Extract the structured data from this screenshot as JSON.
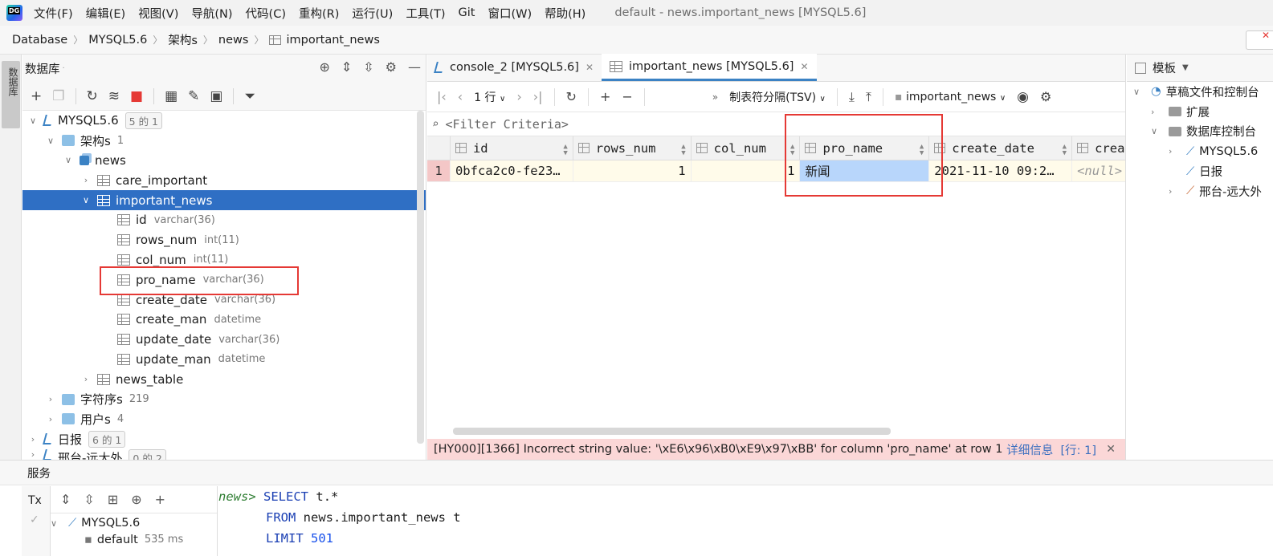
{
  "menu": {
    "items": [
      "文件(F)",
      "编辑(E)",
      "视图(V)",
      "导航(N)",
      "代码(C)",
      "重构(R)",
      "运行(U)",
      "工具(T)",
      "Git",
      "窗口(W)",
      "帮助(H)"
    ],
    "title": "default - news.important_news [MYSQL5.6]"
  },
  "breadcrumb": [
    "Database",
    "MYSQL5.6",
    "架构s",
    "news",
    "important_news"
  ],
  "leftstrip": {
    "tab_label": "数据库"
  },
  "db_panel": {
    "title": "数据库",
    "tree": {
      "root": {
        "label": "MYSQL5.6",
        "badge": "5 的 1"
      },
      "schemas": {
        "label": "架构s",
        "count": "1"
      },
      "news": {
        "label": "news"
      },
      "care_important": {
        "label": "care_important"
      },
      "important_news": {
        "label": "important_news"
      },
      "columns": [
        {
          "name": "id",
          "type": "varchar(36)"
        },
        {
          "name": "rows_num",
          "type": "int(11)"
        },
        {
          "name": "col_num",
          "type": "int(11)"
        },
        {
          "name": "pro_name",
          "type": "varchar(36)"
        },
        {
          "name": "create_date",
          "type": "varchar(36)"
        },
        {
          "name": "create_man",
          "type": "datetime"
        },
        {
          "name": "update_date",
          "type": "varchar(36)"
        },
        {
          "name": "update_man",
          "type": "datetime"
        }
      ],
      "news_table": {
        "label": "news_table"
      },
      "collations": {
        "label": "字符序s",
        "count": "219"
      },
      "users": {
        "label": "用户s",
        "count": "4"
      },
      "ribao": {
        "label": "日报",
        "badge": "6 的 1"
      },
      "xingtai": {
        "label": "邢台-远大外",
        "badge": "0 的 2"
      }
    }
  },
  "editor": {
    "tabs": [
      {
        "label": "console_2 [MYSQL5.6]"
      },
      {
        "label": "important_news [MYSQL5.6]"
      }
    ],
    "toolbar": {
      "rows": "1 行",
      "format": "制表符分隔(TSV)",
      "target": "important_news"
    },
    "filter_placeholder": "<Filter Criteria>",
    "grid": {
      "headers": [
        "id",
        "rows_num",
        "col_num",
        "pro_name",
        "create_date",
        "crea"
      ],
      "rows": [
        {
          "num": "1",
          "cells": [
            "0bfca2c0-fe23…",
            "1",
            "1",
            "新闻",
            "2021-11-10 09:2…",
            "<null>"
          ]
        }
      ]
    },
    "error": {
      "message": "[HY000][1366] Incorrect string value: '\\xE6\\x96\\xB0\\xE9\\x97\\xBB' for column 'pro_name' at row 1",
      "details": "详细信息",
      "line": "[行: 1]"
    }
  },
  "right_panel": {
    "title": "模板",
    "items": [
      {
        "label": "草稿文件和控制台"
      },
      {
        "label": "扩展"
      },
      {
        "label": "数据库控制台"
      },
      {
        "label": "MYSQL5.6"
      },
      {
        "label": "日报"
      },
      {
        "label": "邢台-远大外"
      }
    ]
  },
  "services": {
    "title": "服务",
    "tx": "Tx",
    "tree": [
      {
        "label": "MYSQL5.6"
      },
      {
        "label": "default",
        "time": "535 ms"
      }
    ],
    "code": {
      "prompt": "news>",
      "line1_kw": "SELECT",
      "line1_rest": "t.*",
      "line2_kw": "FROM",
      "line2_rest": "news.important_news t",
      "line3_kw": "LIMIT",
      "line3_num": "501"
    }
  },
  "colors": {
    "accent": "#2f6fc4",
    "error_bg": "#fbd7d7",
    "highlight_box": "#e53935"
  }
}
